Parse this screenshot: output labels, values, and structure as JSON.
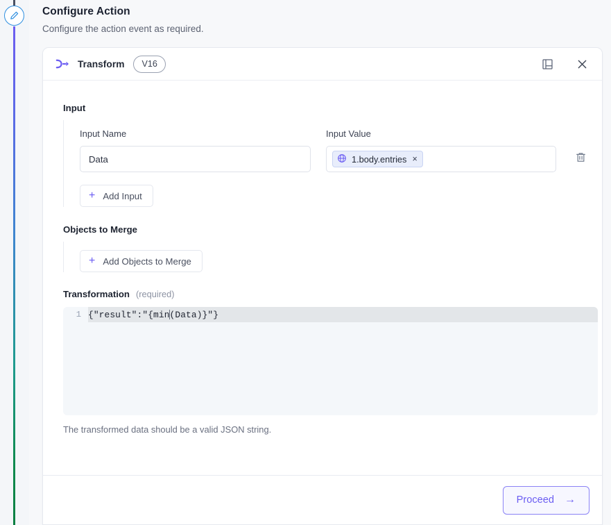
{
  "rail": {
    "step_icon": "pencil-edit-icon",
    "connector_top_color": "#6d5ef0",
    "connector_bottom_color": "#0a8042",
    "badge_border_color": "#2f8fe0"
  },
  "header": {
    "title": "Configure Action",
    "subtitle": "Configure the action event as required."
  },
  "card": {
    "brand_icon": "transform-arrow-icon",
    "brand_name": "Transform",
    "version": "V16",
    "actions": [
      {
        "name": "docs-book-icon",
        "label": ""
      },
      {
        "name": "close-icon",
        "label": ""
      }
    ]
  },
  "input_section": {
    "heading": "Input",
    "columns": {
      "name_label": "Input Name",
      "value_label": "Input Value"
    },
    "rows": [
      {
        "name_value": "Data",
        "name_placeholder": "Input Name",
        "value_chip": {
          "icon": "globe-icon",
          "text": "1.body.entries",
          "remove": "×"
        },
        "delete_icon": "trash-icon"
      }
    ],
    "add_button": {
      "icon": "plus-icon",
      "label": "Add Input"
    }
  },
  "merge_section": {
    "heading": "Objects to Merge",
    "add_button": {
      "icon": "plus-icon",
      "label": "Add Objects to Merge"
    }
  },
  "transformation_section": {
    "heading": "Transformation",
    "required_tag": "(required)",
    "editor": {
      "line_number": "1",
      "code_before_caret": "{\"result\":\"{min",
      "code_after_caret": "(Data)}\"}"
    },
    "hint": "The transformed data should be a valid JSON string."
  },
  "footer": {
    "proceed_label": "Proceed",
    "proceed_arrow": "→",
    "accent_color": "#6b5df2"
  }
}
